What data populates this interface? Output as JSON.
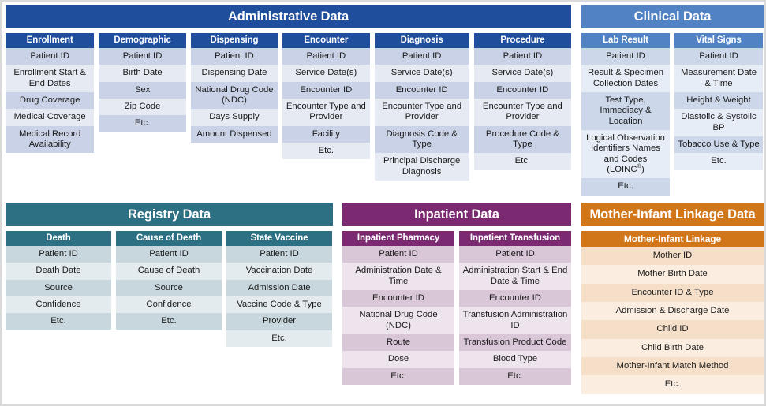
{
  "groups": [
    {
      "id": "administrative-data",
      "title": "Administrative Data",
      "color": "#1f4e9c",
      "columns": [
        {
          "id": "enrollment",
          "header": "Enrollment",
          "rows": [
            "Patient ID",
            "Enrollment Start & End Dates",
            "Drug Coverage",
            "Medical Coverage",
            "Medical Record Availability"
          ]
        },
        {
          "id": "demographic",
          "header": "Demographic",
          "rows": [
            "Patient ID",
            "Birth Date",
            "Sex",
            "Zip Code",
            "Etc."
          ]
        },
        {
          "id": "dispensing",
          "header": "Dispensing",
          "rows": [
            "Patient ID",
            "Dispensing Date",
            "National Drug Code (NDC)",
            "Days Supply",
            "Amount Dispensed"
          ]
        },
        {
          "id": "encounter",
          "header": "Encounter",
          "rows": [
            "Patient ID",
            "Service Date(s)",
            "Encounter ID",
            "Encounter Type and Provider",
            "Facility",
            "Etc."
          ]
        },
        {
          "id": "diagnosis",
          "header": "Diagnosis",
          "rows": [
            "Patient ID",
            "Service Date(s)",
            "Encounter ID",
            "Encounter Type and Provider",
            "Diagnosis Code & Type",
            "Principal Discharge Diagnosis"
          ]
        },
        {
          "id": "procedure",
          "header": "Procedure",
          "rows": [
            "Patient ID",
            "Service Date(s)",
            "Encounter ID",
            "Encounter Type and Provider",
            "Procedure Code & Type",
            "Etc."
          ]
        }
      ]
    },
    {
      "id": "clinical-data",
      "title": "Clinical Data",
      "color": "#5182c3",
      "columns": [
        {
          "id": "lab-result",
          "header": "Lab Result",
          "rows": [
            "Patient ID",
            "Result & Specimen Collection Dates",
            "Test Type, Immediacy & Location",
            "Logical Observation Identifiers Names and Codes (LOINC®)",
            "Etc."
          ],
          "superscript_rows": [
            3
          ]
        },
        {
          "id": "vital-signs",
          "header": "Vital Signs",
          "rows": [
            "Patient ID",
            "Measurement Date & Time",
            "Height & Weight",
            "Diastolic & Systolic BP",
            "Tobacco Use & Type",
            "Etc."
          ]
        }
      ]
    },
    {
      "id": "registry-data",
      "title": "Registry Data",
      "color": "#2d7084",
      "columns": [
        {
          "id": "death",
          "header": "Death",
          "rows": [
            "Patient ID",
            "Death Date",
            "Source",
            "Confidence",
            "Etc."
          ]
        },
        {
          "id": "cause-of-death",
          "header": "Cause of Death",
          "rows": [
            "Patient ID",
            "Cause of Death",
            "Source",
            "Confidence",
            "Etc."
          ]
        },
        {
          "id": "state-vaccine",
          "header": "State Vaccine",
          "rows": [
            "Patient ID",
            "Vaccination Date",
            "Admission Date",
            "Vaccine Code & Type",
            "Provider",
            "Etc."
          ]
        }
      ]
    },
    {
      "id": "inpatient-data",
      "title": "Inpatient Data",
      "color": "#7b2a72",
      "columns": [
        {
          "id": "inpatient-pharmacy",
          "header": "Inpatient Pharmacy",
          "rows": [
            "Patient ID",
            "Administration Date & Time",
            "Encounter ID",
            "National Drug Code (NDC)",
            "Route",
            "Dose",
            "Etc."
          ]
        },
        {
          "id": "inpatient-transfusion",
          "header": "Inpatient Transfusion",
          "rows": [
            "Patient ID",
            "Administration Start & End Date & Time",
            "Encounter ID",
            "Transfusion Administration ID",
            "Transfusion Product Code",
            "Blood Type",
            "Etc."
          ]
        }
      ]
    },
    {
      "id": "mother-infant-linkage-data",
      "title": "Mother-Infant Linkage Data",
      "color": "#d2761a",
      "columns": [
        {
          "id": "mother-infant-linkage",
          "header": "Mother-Infant Linkage",
          "rows": [
            "Mother ID",
            "Mother Birth Date",
            "Encounter ID & Type",
            "Admission & Discharge Date",
            "Child ID",
            "Child Birth Date",
            "Mother-Infant Match Method",
            "Etc."
          ]
        }
      ]
    }
  ]
}
